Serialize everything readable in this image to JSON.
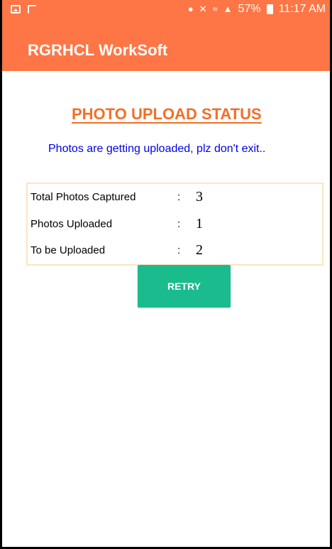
{
  "status_bar": {
    "battery": "57%",
    "time": "11:17 AM",
    "icons": [
      "gallery-icon",
      "cast-icon",
      "location-icon",
      "mute-icon",
      "wifi-icon",
      "signal-icon",
      "battery-icon"
    ]
  },
  "app_bar": {
    "title": "RGRHCL WorkSoft",
    "color": "#fe7645"
  },
  "page": {
    "heading": "PHOTO UPLOAD STATUS",
    "heading_color": "#f36f27",
    "message": "Photos are getting uploaded, plz don't exit..",
    "message_color": "#0000e6"
  },
  "summary": {
    "rows": [
      {
        "label": "Total Photos Captured",
        "colon": ":",
        "value": "3"
      },
      {
        "label": "Photos Uploaded",
        "colon": ":",
        "value": "1"
      },
      {
        "label": "To be Uploaded",
        "colon": ":",
        "value": "2"
      }
    ]
  },
  "actions": {
    "retry_label": "RETRY",
    "retry_color": "#1abc8d"
  }
}
